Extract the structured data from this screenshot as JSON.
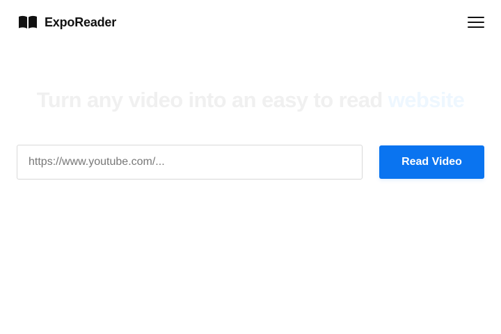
{
  "header": {
    "brand_icon": "open-book-icon",
    "brand_name": "ExpoReader",
    "menu_icon": "hamburger-menu-icon"
  },
  "hero": {
    "headline_main": "Turn any video into an easy to read ",
    "headline_accent": "website"
  },
  "form": {
    "url_placeholder": "https://www.youtube.com/...",
    "url_value": "",
    "submit_label": "Read Video"
  },
  "colors": {
    "accent": "#0a74f0",
    "text": "#111111",
    "headline_faded": "#f0f0f0",
    "headline_accent_faded": "#eef7ff"
  }
}
